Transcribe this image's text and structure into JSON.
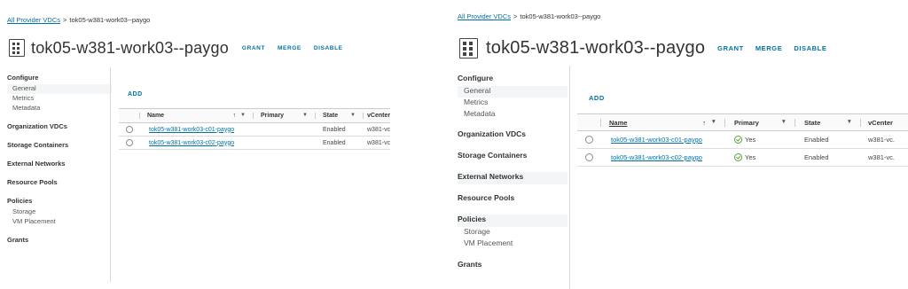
{
  "breadcrumb": {
    "parent": "All Provider VDCs",
    "separator": ">",
    "current": "tok05-w381-work03--paygo"
  },
  "header": {
    "title": "tok05-w381-work03--paygo",
    "actions": [
      "GRANT",
      "MERGE",
      "DISABLE"
    ]
  },
  "nav": {
    "configure": "Configure",
    "configure_items": [
      "General",
      "Metrics",
      "Metadata"
    ],
    "organization_vdcs": "Organization VDCs",
    "storage_containers": "Storage Containers",
    "external_networks": "External Networks",
    "resource_pools": "Resource Pools",
    "policies": "Policies",
    "policies_items": [
      "Storage",
      "VM Placement"
    ],
    "grants": "Grants"
  },
  "toolbar": {
    "add_label": "ADD"
  },
  "grid": {
    "columns": [
      "Name",
      "Primary",
      "State",
      "vCenter"
    ],
    "sort_glyph": "↑",
    "filter_glyph": "▼",
    "rows": [
      {
        "name": "tok05-w381-work03-c01-paygo",
        "primary": "Yes",
        "state": "Enabled",
        "vcenter_a": "w381-vc.v",
        "vcenter_b": "w381-vc."
      },
      {
        "name": "tok05-w381-work03-c02-paygo",
        "primary": "Yes",
        "state": "Enabled",
        "vcenter_a": "w381-vc.v",
        "vcenter_b": "w381-vc."
      }
    ]
  },
  "colors": {
    "link": "#0072a3",
    "check": "#5a9f3b",
    "text": "#333333"
  }
}
